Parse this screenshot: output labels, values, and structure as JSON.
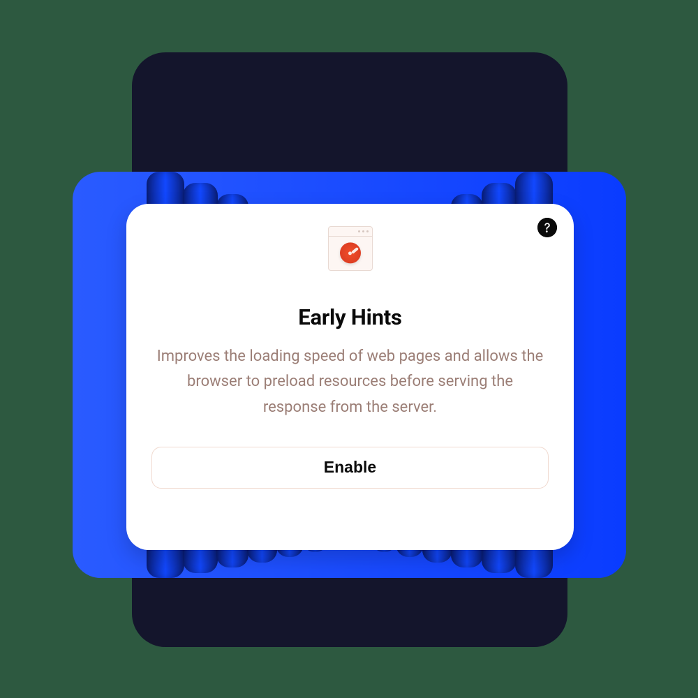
{
  "card": {
    "title": "Early Hints",
    "description": "Improves the loading speed of web pages and allows the browser to preload resources before serving the response from the server.",
    "button_label": "Enable"
  }
}
